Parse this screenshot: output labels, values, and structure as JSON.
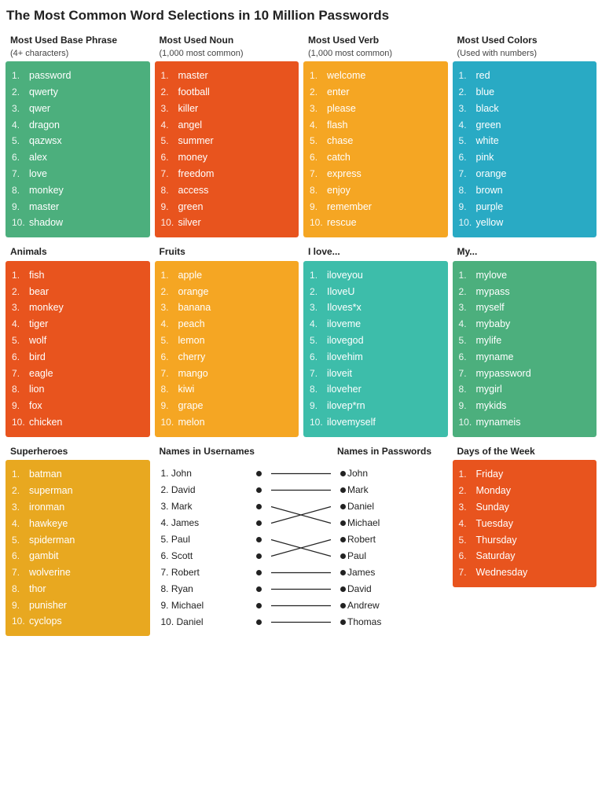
{
  "title": "The Most Common Word Selections in 10 Million Passwords",
  "sections": {
    "base_phrase": {
      "header": "Most Used Base Phrase",
      "sub": "(4+ characters)",
      "color": "bg-green",
      "items": [
        "password",
        "qwerty",
        "qwer",
        "dragon",
        "qazwsx",
        "alex",
        "love",
        "monkey",
        "master",
        "shadow"
      ]
    },
    "noun": {
      "header": "Most Used Noun",
      "sub": "(1,000 most common)",
      "color": "bg-orange",
      "items": [
        "master",
        "football",
        "killer",
        "angel",
        "summer",
        "money",
        "freedom",
        "access",
        "green",
        "silver"
      ]
    },
    "verb": {
      "header": "Most Used Verb",
      "sub": "(1,000 most common)",
      "color": "bg-yellow",
      "items": [
        "welcome",
        "enter",
        "please",
        "flash",
        "chase",
        "catch",
        "express",
        "enjoy",
        "remember",
        "rescue"
      ]
    },
    "colors": {
      "header": "Most Used Colors",
      "sub": "(Used with numbers)",
      "color": "bg-blue",
      "items": [
        "red",
        "blue",
        "black",
        "green",
        "white",
        "pink",
        "orange",
        "brown",
        "purple",
        "yellow"
      ]
    },
    "animals": {
      "header": "Animals",
      "sub": "",
      "color": "bg-orange",
      "items": [
        "fish",
        "bear",
        "monkey",
        "tiger",
        "wolf",
        "bird",
        "eagle",
        "lion",
        "fox",
        "chicken"
      ]
    },
    "fruits": {
      "header": "Fruits",
      "sub": "",
      "color": "bg-yellow",
      "items": [
        "apple",
        "orange",
        "banana",
        "peach",
        "lemon",
        "cherry",
        "mango",
        "kiwi",
        "grape",
        "melon"
      ]
    },
    "ilove": {
      "header": "I love...",
      "sub": "",
      "color": "bg-teal",
      "items": [
        "iloveyou",
        "IloveU",
        "Iloves*x",
        "iloveme",
        "ilovegod",
        "ilovehim",
        "iloveit",
        "iloveher",
        "ilovep*rn",
        "ilovemyself"
      ]
    },
    "my": {
      "header": "My...",
      "sub": "",
      "color": "bg-green",
      "items": [
        "mylove",
        "mypass",
        "myself",
        "mybaby",
        "mylife",
        "myname",
        "mypassword",
        "mygirl",
        "mykids",
        "mynameis"
      ]
    },
    "superheroes": {
      "header": "Superheroes",
      "sub": "",
      "color": "bg-gold",
      "items": [
        "batman",
        "superman",
        "ironman",
        "hawkeye",
        "spiderman",
        "gambit",
        "wolverine",
        "thor",
        "punisher",
        "cyclops"
      ]
    },
    "names_usernames": {
      "header": "Names in Usernames",
      "items": [
        "John",
        "David",
        "Mark",
        "James",
        "Paul",
        "Scott",
        "Robert",
        "Ryan",
        "Michael",
        "Daniel"
      ]
    },
    "names_passwords": {
      "header": "Names in Passwords",
      "items": [
        "John",
        "Mark",
        "Daniel",
        "Michael",
        "Robert",
        "Paul",
        "James",
        "David",
        "Andrew",
        "Thomas"
      ]
    },
    "days": {
      "header": "Days of the Week",
      "sub": "",
      "color": "bg-orange",
      "items": [
        "Friday",
        "Monday",
        "Sunday",
        "Tuesday",
        "Thursday",
        "Saturday",
        "Wednesday"
      ]
    }
  },
  "names_lines": [
    [
      0,
      0
    ],
    [
      1,
      1
    ],
    [
      2,
      3
    ],
    [
      3,
      2
    ],
    [
      4,
      5
    ],
    [
      5,
      4
    ],
    [
      6,
      6
    ],
    [
      7,
      7
    ],
    [
      8,
      8
    ],
    [
      9,
      9
    ]
  ]
}
